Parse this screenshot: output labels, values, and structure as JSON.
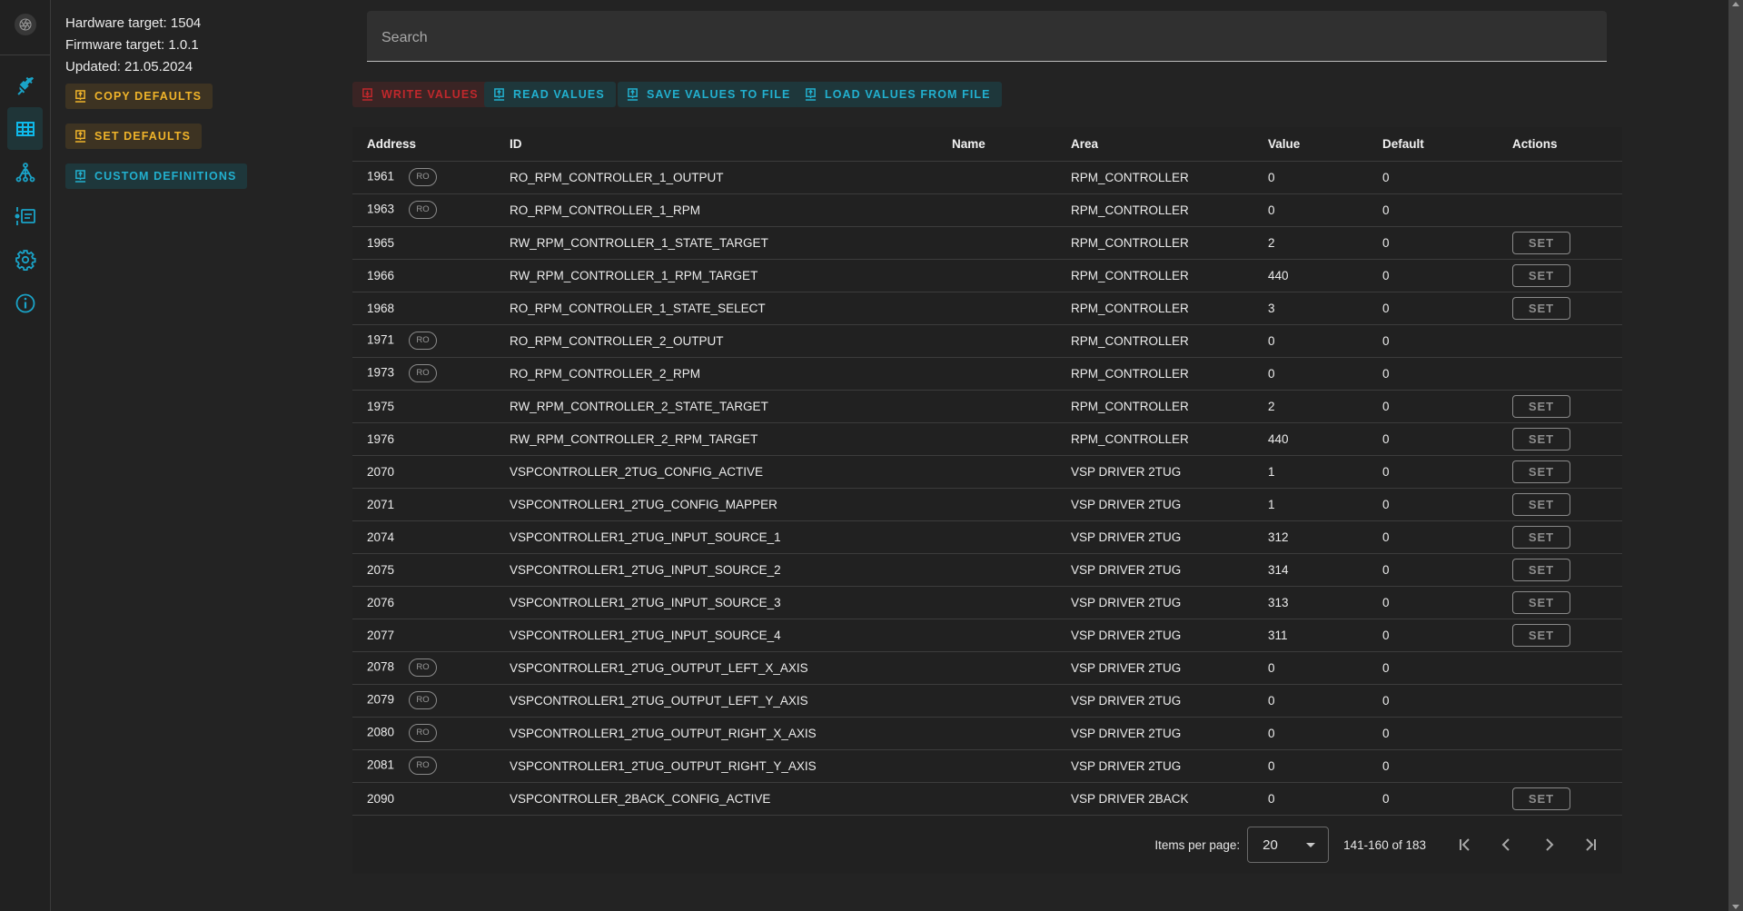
{
  "rail": {
    "logo_icon": "aperture-icon",
    "items": [
      {
        "name": "plug-icon",
        "active": false
      },
      {
        "name": "table-icon",
        "active": true
      },
      {
        "name": "hierarchy-icon",
        "active": false
      },
      {
        "name": "list-icon",
        "active": false
      },
      {
        "name": "gear-icon",
        "active": false
      },
      {
        "name": "info-icon",
        "active": false
      }
    ]
  },
  "info": {
    "hardware": "Hardware target: 1504",
    "firmware": "Firmware target: 1.0.1",
    "updated": "Updated: 21.05.2024"
  },
  "side_buttons": {
    "copy_defaults": "COPY DEFAULTS",
    "set_defaults": "SET DEFAULTS",
    "custom_definitions": "CUSTOM DEFINITIONS"
  },
  "search": {
    "placeholder": "Search",
    "value": ""
  },
  "toolbar": {
    "write_values": "WRITE VALUES",
    "read_values": "READ VALUES",
    "save_values": "SAVE VALUES TO FILE",
    "load_values": "LOAD VALUES FROM FILE"
  },
  "colors": {
    "accent_teal": "#22b0cf",
    "accent_yellow": "#f0b42a",
    "accent_red": "#c0282c",
    "background": "#232323"
  },
  "table": {
    "columns": [
      "Address",
      "ID",
      "Name",
      "Area",
      "Value",
      "Default",
      "Actions"
    ],
    "ro_label": "RO",
    "set_label": "SET",
    "rows": [
      {
        "address": "1961",
        "ro": true,
        "id": "RO_RPM_CONTROLLER_1_OUTPUT",
        "name": "",
        "area": "RPM_CONTROLLER",
        "value": "0",
        "default": "0",
        "settable": false
      },
      {
        "address": "1963",
        "ro": true,
        "id": "RO_RPM_CONTROLLER_1_RPM",
        "name": "",
        "area": "RPM_CONTROLLER",
        "value": "0",
        "default": "0",
        "settable": false
      },
      {
        "address": "1965",
        "ro": false,
        "id": "RW_RPM_CONTROLLER_1_STATE_TARGET",
        "name": "",
        "area": "RPM_CONTROLLER",
        "value": "2",
        "default": "0",
        "settable": true
      },
      {
        "address": "1966",
        "ro": false,
        "id": "RW_RPM_CONTROLLER_1_RPM_TARGET",
        "name": "",
        "area": "RPM_CONTROLLER",
        "value": "440",
        "default": "0",
        "settable": true
      },
      {
        "address": "1968",
        "ro": false,
        "id": "RO_RPM_CONTROLLER_1_STATE_SELECT",
        "name": "",
        "area": "RPM_CONTROLLER",
        "value": "3",
        "default": "0",
        "settable": true
      },
      {
        "address": "1971",
        "ro": true,
        "id": "RO_RPM_CONTROLLER_2_OUTPUT",
        "name": "",
        "area": "RPM_CONTROLLER",
        "value": "0",
        "default": "0",
        "settable": false
      },
      {
        "address": "1973",
        "ro": true,
        "id": "RO_RPM_CONTROLLER_2_RPM",
        "name": "",
        "area": "RPM_CONTROLLER",
        "value": "0",
        "default": "0",
        "settable": false
      },
      {
        "address": "1975",
        "ro": false,
        "id": "RW_RPM_CONTROLLER_2_STATE_TARGET",
        "name": "",
        "area": "RPM_CONTROLLER",
        "value": "2",
        "default": "0",
        "settable": true
      },
      {
        "address": "1976",
        "ro": false,
        "id": "RW_RPM_CONTROLLER_2_RPM_TARGET",
        "name": "",
        "area": "RPM_CONTROLLER",
        "value": "440",
        "default": "0",
        "settable": true
      },
      {
        "address": "2070",
        "ro": false,
        "id": "VSPCONTROLLER_2TUG_CONFIG_ACTIVE",
        "name": "",
        "area": "VSP DRIVER 2TUG",
        "value": "1",
        "default": "0",
        "settable": true
      },
      {
        "address": "2071",
        "ro": false,
        "id": "VSPCONTROLLER1_2TUG_CONFIG_MAPPER",
        "name": "",
        "area": "VSP DRIVER 2TUG",
        "value": "1",
        "default": "0",
        "settable": true
      },
      {
        "address": "2074",
        "ro": false,
        "id": "VSPCONTROLLER1_2TUG_INPUT_SOURCE_1",
        "name": "",
        "area": "VSP DRIVER 2TUG",
        "value": "312",
        "default": "0",
        "settable": true
      },
      {
        "address": "2075",
        "ro": false,
        "id": "VSPCONTROLLER1_2TUG_INPUT_SOURCE_2",
        "name": "",
        "area": "VSP DRIVER 2TUG",
        "value": "314",
        "default": "0",
        "settable": true
      },
      {
        "address": "2076",
        "ro": false,
        "id": "VSPCONTROLLER1_2TUG_INPUT_SOURCE_3",
        "name": "",
        "area": "VSP DRIVER 2TUG",
        "value": "313",
        "default": "0",
        "settable": true
      },
      {
        "address": "2077",
        "ro": false,
        "id": "VSPCONTROLLER1_2TUG_INPUT_SOURCE_4",
        "name": "",
        "area": "VSP DRIVER 2TUG",
        "value": "311",
        "default": "0",
        "settable": true
      },
      {
        "address": "2078",
        "ro": true,
        "id": "VSPCONTROLLER1_2TUG_OUTPUT_LEFT_X_AXIS",
        "name": "",
        "area": "VSP DRIVER 2TUG",
        "value": "0",
        "default": "0",
        "settable": false
      },
      {
        "address": "2079",
        "ro": true,
        "id": "VSPCONTROLLER1_2TUG_OUTPUT_LEFT_Y_AXIS",
        "name": "",
        "area": "VSP DRIVER 2TUG",
        "value": "0",
        "default": "0",
        "settable": false
      },
      {
        "address": "2080",
        "ro": true,
        "id": "VSPCONTROLLER1_2TUG_OUTPUT_RIGHT_X_AXIS",
        "name": "",
        "area": "VSP DRIVER 2TUG",
        "value": "0",
        "default": "0",
        "settable": false
      },
      {
        "address": "2081",
        "ro": true,
        "id": "VSPCONTROLLER1_2TUG_OUTPUT_RIGHT_Y_AXIS",
        "name": "",
        "area": "VSP DRIVER 2TUG",
        "value": "0",
        "default": "0",
        "settable": false
      },
      {
        "address": "2090",
        "ro": false,
        "id": "VSPCONTROLLER_2BACK_CONFIG_ACTIVE",
        "name": "",
        "area": "VSP DRIVER 2BACK",
        "value": "0",
        "default": "0",
        "settable": true
      }
    ]
  },
  "paginator": {
    "label": "Items per page:",
    "page_size": "20",
    "range": "141-160 of 183"
  }
}
